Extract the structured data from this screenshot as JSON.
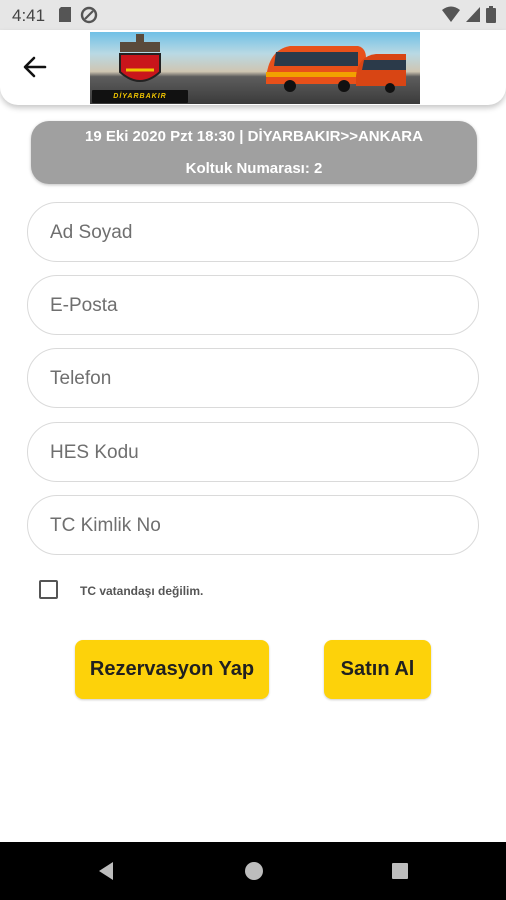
{
  "status_bar": {
    "time": "4:41"
  },
  "banner": {
    "logo_text": "DİYARBAKIR"
  },
  "trip": {
    "summary": "19 Eki 2020 Pzt 18:30 | DİYARBAKIR>>ANKARA",
    "seat": "Koltuk Numarası: 2"
  },
  "form": {
    "name_placeholder": "Ad Soyad",
    "email_placeholder": "E-Posta",
    "phone_placeholder": "Telefon",
    "hes_placeholder": "HES Kodu",
    "tc_placeholder": "TC Kimlik No",
    "not_citizen_label": "TC vatandaşı değilim."
  },
  "actions": {
    "reserve_label": "Rezervasyon Yap",
    "buy_label": "Satın Al"
  },
  "colors": {
    "accent": "#fdd20a",
    "trip_box": "#a0a0a0"
  }
}
